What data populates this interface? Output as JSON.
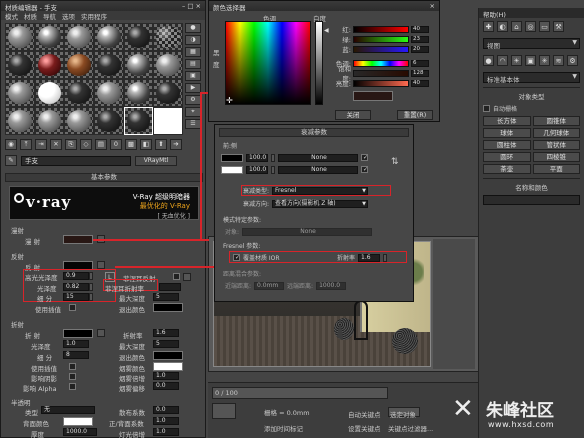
{
  "material_editor": {
    "title": "材质编辑器 - 手支",
    "menu": [
      "模式",
      "材质",
      "导航",
      "选项",
      "实用程序"
    ],
    "material_name": "手支",
    "material_type": "VRayMtl",
    "basic_params_title": "基本参数",
    "banner": {
      "logo": "v·ray",
      "line1": "V-Ray 超级明暗器",
      "line2": "最优化的 V-Ray",
      "line3": "[ 无血优化 ]"
    },
    "diffuse_group": "漫射",
    "diffuse_label": "漫 射",
    "reflection_group": "反射",
    "reflect_label": "反 射",
    "hilight_gloss_label": "高光光泽度",
    "hilight_gloss_value": "0.9",
    "l_button": "L",
    "fresnel_label": "菲涅耳反射",
    "gloss_label": "光泽度",
    "gloss_value": "0.82",
    "fresnel_ior_label": "菲涅耳折射率",
    "subdiv_label": "细 分",
    "subdiv_value": "15",
    "max_depth_label": "最大深度",
    "max_depth_value": "5",
    "use_interp_label": "使用插值",
    "exit_color_label": "退出颜色",
    "refraction_group": "折射",
    "refract_label": "折 射",
    "ior_label": "折射率",
    "ior_value": "1.6",
    "r_gloss_label": "光泽度",
    "r_gloss_value": "1.0",
    "r_max_depth_label": "最大深度",
    "r_max_depth_value": "5",
    "r_subdiv_label": "细 分",
    "r_subdiv_value": "8",
    "r_exit_label": "退出颜色",
    "r_use_interp_label": "使用插值",
    "fog_color_label": "烟雾颜色",
    "affect_shadow_label": "影响阴影",
    "fog_mult_label": "烟雾倍增",
    "fog_mult_value": "1.0",
    "affect_ch_label": "影响 Alpha",
    "fog_bias_label": "烟雾偏移",
    "fog_bias_value": "0.0",
    "translucency_group": "半透明",
    "type_label": "类型",
    "type_value": "无",
    "back_color_label": "背面颜色",
    "scatter_label": "散布系数",
    "scatter_value": "0.0",
    "fwd_back_label": "正/背面系数",
    "fwd_back_value": "1.0",
    "thickness_label": "厚度",
    "thickness_value": "1000.0",
    "light_mult_label": "灯光倍增",
    "light_mult_value": "1.0"
  },
  "color_selector": {
    "title": "颜色选择器",
    "hue_label": "色调",
    "white_label": "白度",
    "side_labels": [
      "黑",
      "度"
    ],
    "rows": [
      {
        "label": "红:",
        "value": "40"
      },
      {
        "label": "绿:",
        "value": "23"
      },
      {
        "label": "蓝:",
        "value": "20"
      },
      {
        "label": "色调:",
        "value": "6"
      },
      {
        "label": "饱和度:",
        "value": "128"
      },
      {
        "label": "亮度:",
        "value": "40"
      }
    ],
    "close_label": "关闭",
    "reset_label": "重置(R)"
  },
  "falloff": {
    "title": "衰减参数",
    "front_side": "前:侧",
    "val1": "100.0",
    "val2": "100.0",
    "none1": "None",
    "none2": "None",
    "type_label": "衰减类型:",
    "type_value": "Fresnel",
    "dir_label": "衰减方向:",
    "dir_value": "查看方向(摄影机 Z 轴)",
    "mode_title": "模式特定参数:",
    "object_label": "对象:",
    "object_value": "None",
    "fresnel_title": "Fresnel 参数:",
    "override_label": "覆盖材质 IOR",
    "ior_label": "折射率",
    "ior_value": "1.6",
    "dist_title": "距离混合参数:",
    "near_label": "近端距离:",
    "near_value": "0.0mm",
    "far_label": "远端距离:",
    "far_value": "1000.0"
  },
  "command_panel": {
    "title": "帮助(H)",
    "dropdown1": "视图",
    "dropdown2": "标准基本体",
    "object_types": "对象类型",
    "auto_grid": "自动栅格",
    "buttons": [
      "长方体",
      "圆锥体",
      "球体",
      "几何球体",
      "圆柱体",
      "管状体",
      "圆环",
      "四棱锥",
      "茶壶",
      "平面"
    ],
    "name_color": "名称和颜色"
  },
  "timeline": {
    "frame": "0 / 100",
    "grid": "栅格 = 0.0mm",
    "add_time_tag": "添加时间标记",
    "auto_key": "自动关键点",
    "set_key": "设置关键点",
    "selected": "选定对象",
    "key_filter": "关键点过滤器..."
  },
  "watermark": {
    "name": "朱峰社区",
    "url": "www.hxsd.com"
  }
}
